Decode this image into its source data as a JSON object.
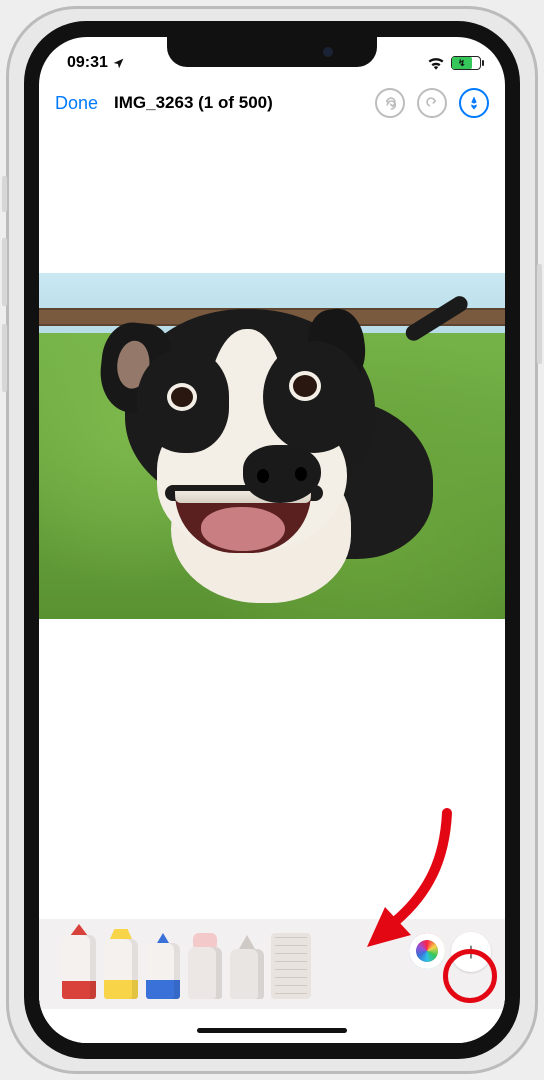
{
  "status": {
    "time": "09:31"
  },
  "nav": {
    "done_label": "Done",
    "title": "IMG_3263 (1 of 500)"
  },
  "toolbar": {
    "add_glyph": "+"
  }
}
